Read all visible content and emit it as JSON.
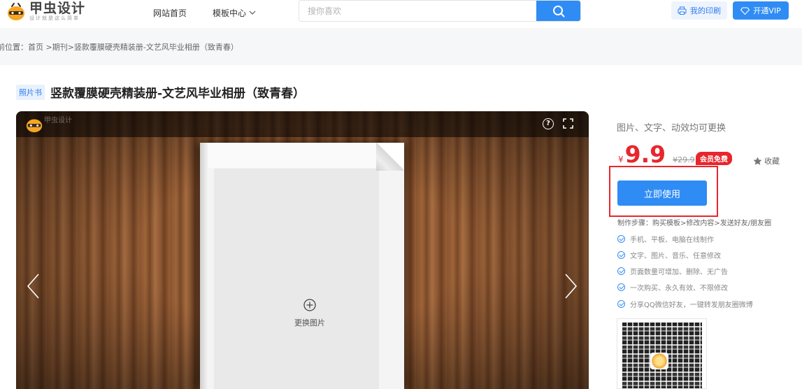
{
  "header": {
    "logo_text": "甲虫设计",
    "logo_slogan": "设计就是这么简单",
    "nav": [
      {
        "label": "网站首页"
      },
      {
        "label": "模板中心"
      }
    ],
    "search_placeholder": "搜你喜欢",
    "print_label": "我的印刷",
    "vip_label": "开通VIP"
  },
  "breadcrumb": {
    "text": "前位置：首页 >期刊>竖款覆膜硬壳精装册-文艺风毕业相册（致青春）"
  },
  "product": {
    "tag": "照片书",
    "title": "竖款覆膜硬壳精装册-文艺风毕业相册（致青春）"
  },
  "preview": {
    "brand": "甲虫设计",
    "help_symbol": "?",
    "replace_label": "更换图片"
  },
  "panel": {
    "description": "图片、文字、动效均可更换",
    "currency": "¥",
    "price": "9.9",
    "old_price": "¥29.9",
    "member_badge": "会员免费",
    "favorite_label": "收藏",
    "use_button": "立即使用",
    "steps": "制作步骤：购买模板>修改内容>发送好友/朋友圈",
    "features": [
      "手机、平板、电脑在线制作",
      "文字、图片、音乐、任意修改",
      "页面数量可增加、删除、无广告",
      "一次购买、永久有效、不限修改",
      "分享QQ微信好友，一键转发朋友圈微博"
    ]
  },
  "colors": {
    "accent": "#2f8cf5",
    "price_red": "#e8262c"
  }
}
